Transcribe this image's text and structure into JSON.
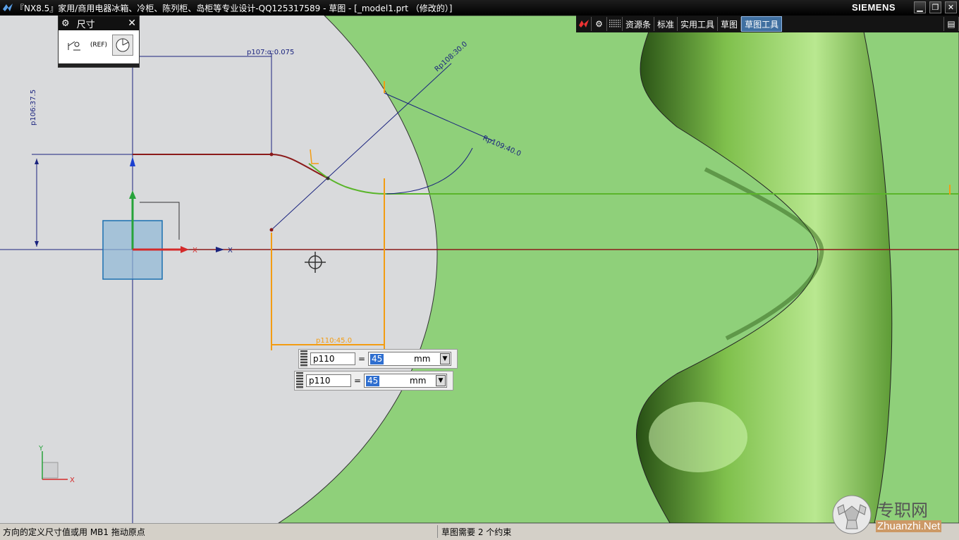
{
  "window": {
    "title": "『NX8.5』家用/商用电器冰箱、冷柜、陈列柜、岛柜等专业设计-QQ125317589 - 草图 - [_model1.prt （修改的）]",
    "brand": "SIEMENS",
    "controls": {
      "minimize": "▁",
      "restore": "❐",
      "close": "✕"
    }
  },
  "toolbar": {
    "tabs": [
      {
        "label": "资源条"
      },
      {
        "label": "标准"
      },
      {
        "label": "实用工具"
      },
      {
        "label": "草图"
      },
      {
        "label": "草图工具",
        "active": true
      }
    ]
  },
  "dimension_palette": {
    "title": "尺寸",
    "ref_label": "(REF)"
  },
  "sketch": {
    "dimension_labels": {
      "p106": "p106:37.5",
      "p107": "p107:α:0.075",
      "p108": "Rp108:30.0",
      "p109": "Rp109:40.0",
      "p110": "p110:45.0"
    },
    "axes": {
      "x": "X",
      "y": "Y"
    }
  },
  "dimension_inputs": [
    {
      "name": "p110",
      "equals": "=",
      "value": "45",
      "unit": "mm"
    },
    {
      "name": "p110",
      "equals": "=",
      "value": "45",
      "unit": "mm"
    }
  ],
  "status_bar": {
    "cue": "方向的定义尺寸值或用 MB1 拖动原点",
    "status": "草图需要 2 个约束"
  },
  "watermark": {
    "cn": "专职网",
    "en": "Zhuanzhi.Net"
  },
  "colors": {
    "background": "#d9dadc",
    "model_green": "#8fd07a",
    "dimension_blue": "#1a237e",
    "curve_red": "#8b1a1a",
    "sketch_green": "#5ab52a",
    "orange": "#f39c12"
  }
}
